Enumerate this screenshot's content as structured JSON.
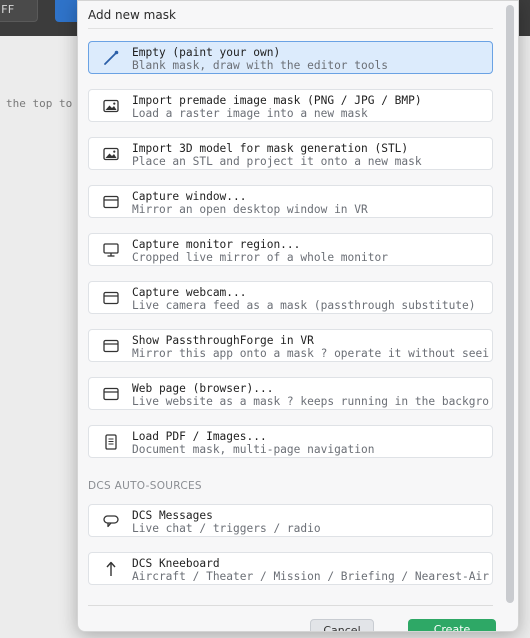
{
  "background": {
    "toggle_label": "FF",
    "hint_text": "the top to"
  },
  "dialog": {
    "title": "Add new mask",
    "items": [
      {
        "icon": "brush-icon",
        "title": "Empty (paint your own)",
        "desc": "Blank mask, draw with the editor tools",
        "selected": true
      },
      {
        "icon": "image-icon",
        "title": "Import premade image mask (PNG / JPG / BMP)",
        "desc": "Load a raster image into a new mask"
      },
      {
        "icon": "image-icon",
        "title": "Import 3D model for mask generation (STL)",
        "desc": "Place an STL and project it onto a new mask"
      },
      {
        "icon": "window-icon",
        "title": "Capture window...",
        "desc": "Mirror an open desktop window in VR"
      },
      {
        "icon": "monitor-icon",
        "title": "Capture monitor region...",
        "desc": "Cropped live mirror of a whole monitor"
      },
      {
        "icon": "window-icon",
        "title": "Capture webcam...",
        "desc": "Live camera feed as a mask (passthrough substitute)"
      },
      {
        "icon": "window-icon",
        "title": "Show PassthroughForge in VR",
        "desc": "Mirror this app onto a mask ? operate it without seei"
      },
      {
        "icon": "window-icon",
        "title": "Web page (browser)...",
        "desc": "Live website as a mask ? keeps running in the backgro"
      },
      {
        "icon": "document-icon",
        "title": "Load PDF / Images...",
        "desc": "Document mask, multi-page navigation"
      }
    ],
    "section_label": "DCS AUTO-SOURCES",
    "dcs_items": [
      {
        "icon": "chat-icon",
        "title": "DCS Messages",
        "desc": "Live chat / triggers / radio"
      },
      {
        "icon": "arrow-up-icon",
        "title": "DCS Kneeboard",
        "desc": "Aircraft / Theater / Mission / Briefing / Nearest-Air"
      }
    ],
    "cancel_label": "Cancel",
    "create_label": "Create"
  },
  "colors": {
    "accent": "#2f73c9",
    "selected_bg": "#dcebfc",
    "selected_border": "#6aa2e4",
    "create_button": "#2ea866"
  }
}
